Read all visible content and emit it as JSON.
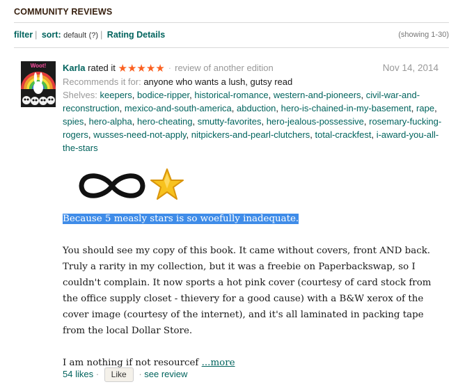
{
  "section": {
    "title": "COMMUNITY REVIEWS"
  },
  "toolbar": {
    "filter": "filter",
    "sort_label": "sort:",
    "sort_value": "default",
    "sort_help": "(?)",
    "rating_details": "Rating Details",
    "showing": "(showing 1-30)"
  },
  "review": {
    "user": "Karla",
    "rated_it": "rated it",
    "stars": "★★★★★",
    "edition_note": "review of another edition",
    "date": "Nov 14, 2014",
    "recommends_label": "Recommends it for:",
    "recommends_value": "anyone who wants a lush, gutsy read",
    "shelves_label": "Shelves:",
    "shelves": [
      "keepers",
      "bodice-ripper",
      "historical-romance",
      "western-and-pioneers",
      "civil-war-and-reconstruction",
      "mexico-and-south-america",
      "abduction",
      "hero-is-chained-in-my-basement",
      "rape",
      "spies",
      "hero-alpha",
      "hero-cheating",
      "smutty-favorites",
      "hero-jealous-possessive",
      "rosemary-fucking-rogers",
      "wusses-need-not-apply",
      "nitpickers-and-pearl-clutchers",
      "total-crackfest",
      "i-award-you-all-the-stars"
    ],
    "highlighted": "Because 5 measly stars is so woefully inadequate.",
    "paragraph": "You should see my copy of this book. It came without covers, front AND back. Truly a rarity in my collection, but it was a freebie on Paperbackswap, so I couldn't complain. It now sports a hot pink cover (courtesy of card stock from the office supply closet - thievery for a good cause) with a B&W xerox of the cover image (courtesy of the internet), and it's all laminated in packing tape from the local Dollar Store.",
    "truncated": "I am nothing if not resourcef",
    "more": "...more",
    "likes": "54 likes",
    "like_button": "Like",
    "see_review": "see review"
  },
  "avatar": {
    "caption": "Woot!",
    "icon": "rainbow-bunny-skulls-avatar"
  },
  "icons": {
    "infinity": "infinity-icon",
    "star": "star-icon"
  },
  "colors": {
    "link": "#00635d",
    "star": "#fb6020",
    "highlight": "#3f8ce8",
    "title": "#382110"
  }
}
